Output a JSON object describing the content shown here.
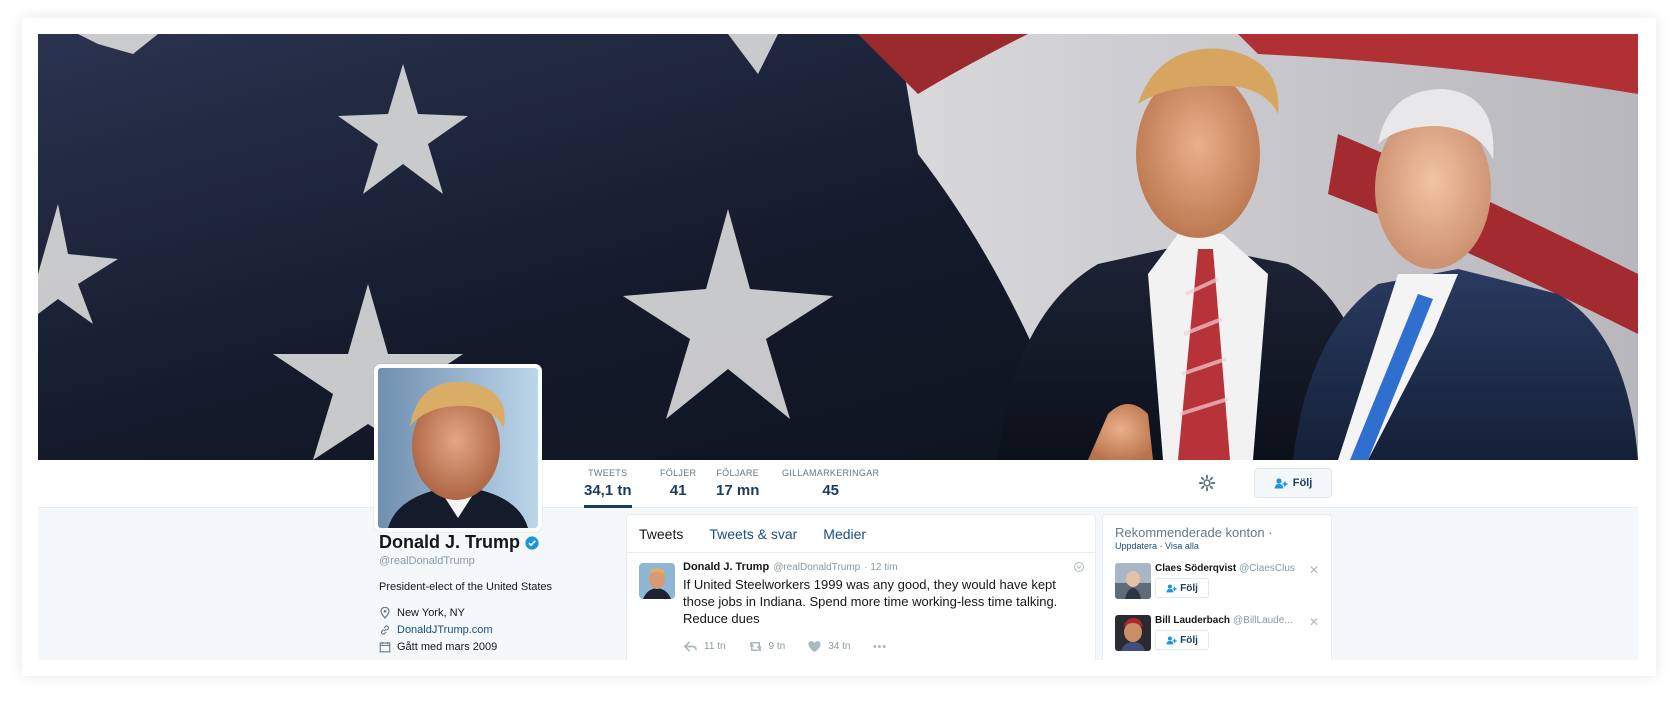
{
  "profile": {
    "name": "Donald J. Trump",
    "handle": "@realDonaldTrump",
    "bio": "President-elect of the United States",
    "location": "New York, NY",
    "website": "DonaldJTrump.com",
    "joined": "Gått med mars 2009"
  },
  "stats": [
    {
      "label": "TWEETS",
      "value": "34,1 tn"
    },
    {
      "label": "FÖLJER",
      "value": "41"
    },
    {
      "label": "FÖLJARE",
      "value": "17 mn"
    },
    {
      "label": "GILLAMARKERINGAR",
      "value": "45"
    }
  ],
  "header": {
    "follow_label": "Följ"
  },
  "timeline": {
    "tabs": [
      "Tweets",
      "Tweets & svar",
      "Medier"
    ],
    "tweet": {
      "name": "Donald J. Trump",
      "handle": "@realDonaldTrump",
      "time": "· 12 tim",
      "text": "If United Steelworkers 1999 was any good, they would have kept those jobs in Indiana. Spend more time working-less time talking. Reduce dues",
      "replies": "11 tn",
      "retweets": "9 tn",
      "likes": "34 tn"
    }
  },
  "recommendations": {
    "title": "Rekommenderade konton ·",
    "refresh": "Uppdatera",
    "view_all": "Visa alla",
    "users": [
      {
        "name": "Claes Söderqvist",
        "handle": "@ClaesClus",
        "follow": "Följ"
      },
      {
        "name": "Bill Lauderbach",
        "handle": "@BillLaude...",
        "follow": "Följ"
      }
    ]
  },
  "colors": {
    "accent": "#1b95e0",
    "link": "#1b4f7c",
    "nav_value": "#1c3b5c",
    "background": "#f5f8fa"
  },
  "icons": [
    "gear-icon",
    "follow-user-icon",
    "verified-badge-icon",
    "location-icon",
    "link-icon",
    "calendar-icon",
    "reply-icon",
    "retweet-icon",
    "like-icon",
    "more-icon",
    "caret-icon",
    "close-icon"
  ]
}
